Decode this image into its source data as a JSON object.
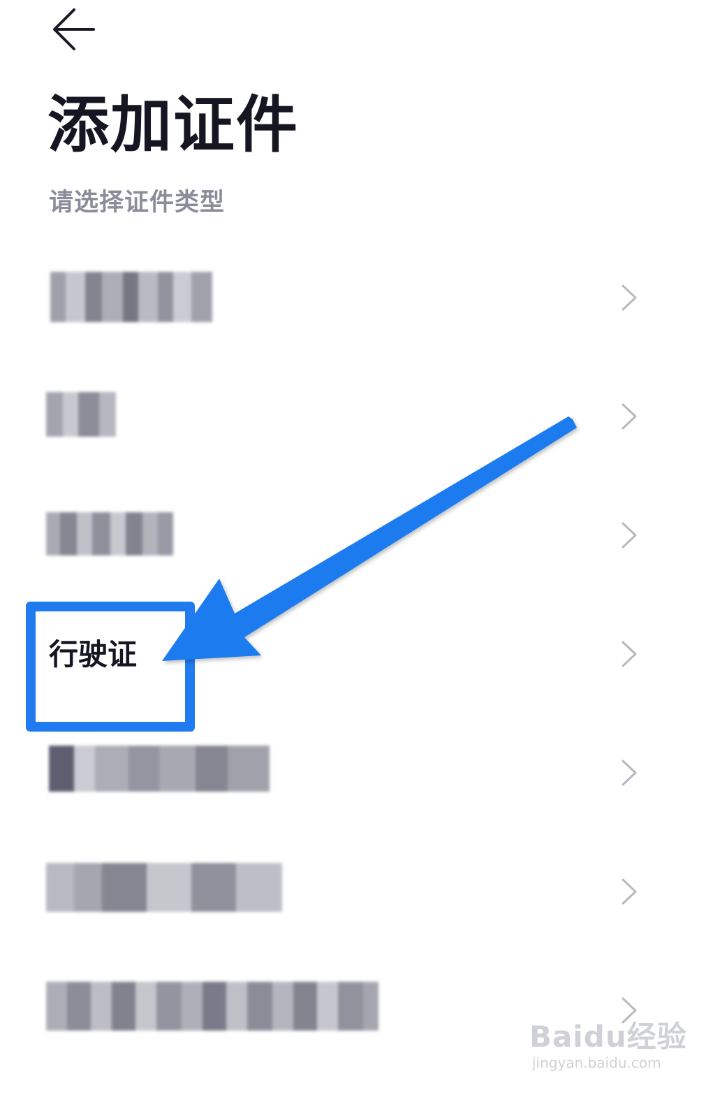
{
  "header": {
    "back_icon": "arrow-left-icon",
    "title": "添加证件",
    "subtitle": "请选择证件类型"
  },
  "list": {
    "chevron_icon": "chevron-right-icon",
    "items": [
      {
        "label": "",
        "redacted": true
      },
      {
        "label": "",
        "redacted": true
      },
      {
        "label": "",
        "redacted": true
      },
      {
        "label": "行驶证",
        "redacted": false,
        "highlighted": true
      },
      {
        "label": "",
        "redacted": true
      },
      {
        "label": "",
        "redacted": true
      },
      {
        "label": "",
        "redacted": true
      }
    ]
  },
  "annotation": {
    "color": "#1f7bef"
  },
  "watermark": {
    "brand": "Baidu经验",
    "domain": "jingyan.baidu.com"
  },
  "colors": {
    "title": "#161622",
    "subtitle": "#8a8d99",
    "accent": "#1f7bef",
    "chevron": "#b7b9c0"
  }
}
